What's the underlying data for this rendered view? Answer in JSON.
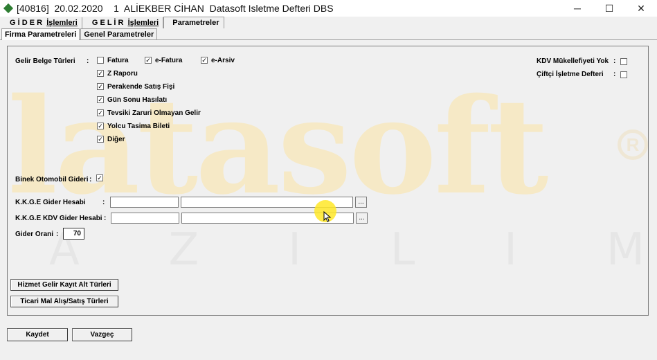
{
  "window": {
    "title": "[40816]  20.02.2020    1  ALİEKBER CİHAN  Datasoft Isletme Defteri DBS",
    "minimize": "─",
    "maximize": "☐",
    "close": "✕"
  },
  "menu": {
    "gider_spaced": "G İ D E R",
    "gider_islemleri": "İşlemleri",
    "gelir_spaced": "G E L İ R",
    "gelir_islemleri": "İşlemleri",
    "parametreler": "Parametreler"
  },
  "subtabs": {
    "firma": "Firma Parametreleri",
    "genel": "Genel Parametreler"
  },
  "gelir_belge": {
    "label": "Gelir Belge Türleri",
    "colon": ":",
    "fatura": {
      "label": "Fatura",
      "checked": false
    },
    "e_fatura": {
      "label": "e-Fatura",
      "checked": true
    },
    "e_arsiv": {
      "label": "e-Arsiv",
      "checked": true
    },
    "z_raporu": {
      "label": "Z Raporu",
      "checked": true
    },
    "perakende": {
      "label": "Perakende Satış Fişi",
      "checked": true
    },
    "gun_sonu": {
      "label": "Gün Sonu Hasılatı",
      "checked": true
    },
    "tevsiki": {
      "label": "Tevsiki Zaruri Olmayan Gelir",
      "checked": true
    },
    "yolcu": {
      "label": "Yolcu Tasima Bileti",
      "checked": true
    },
    "diger": {
      "label": "Diğer",
      "checked": true
    }
  },
  "kdv_mukellefiyeti": {
    "label": "KDV Mükellefiyeti Yok",
    "colon": ":",
    "checked": false
  },
  "ciftci": {
    "label": "Çiftçi İşletme Defteri",
    "colon": ":",
    "checked": false
  },
  "binek": {
    "label": "Binek Otomobil Gideri",
    "colon": ":",
    "checked": true
  },
  "kkeg_gider": {
    "label": "K.K.G.E Gider Hesabi",
    "colon": ":",
    "code": "",
    "name": "",
    "button": "..."
  },
  "kkeg_kdv": {
    "label": "K.K.G.E KDV Gider Hesabi",
    "colon": ":",
    "code": "",
    "name": "",
    "button": "..."
  },
  "gider_orani": {
    "label": "Gider Orani",
    "colon": ":",
    "value": "70"
  },
  "buttons": {
    "hizmet": "Hizmet Gelir Kayıt Alt Türleri",
    "ticari": "Ticari Mal Alış/Satış Türleri",
    "kaydet": "Kaydet",
    "vazgec": "Vazgeç"
  },
  "watermark": {
    "brand": "latasoft",
    "registered": "R",
    "letters": [
      "A",
      "Z",
      "I",
      "L",
      "I",
      "M"
    ]
  },
  "check_glyph": "✓",
  "colors": {
    "watermark": "#f6e9c6",
    "cursor_highlight": "#ffe828"
  }
}
